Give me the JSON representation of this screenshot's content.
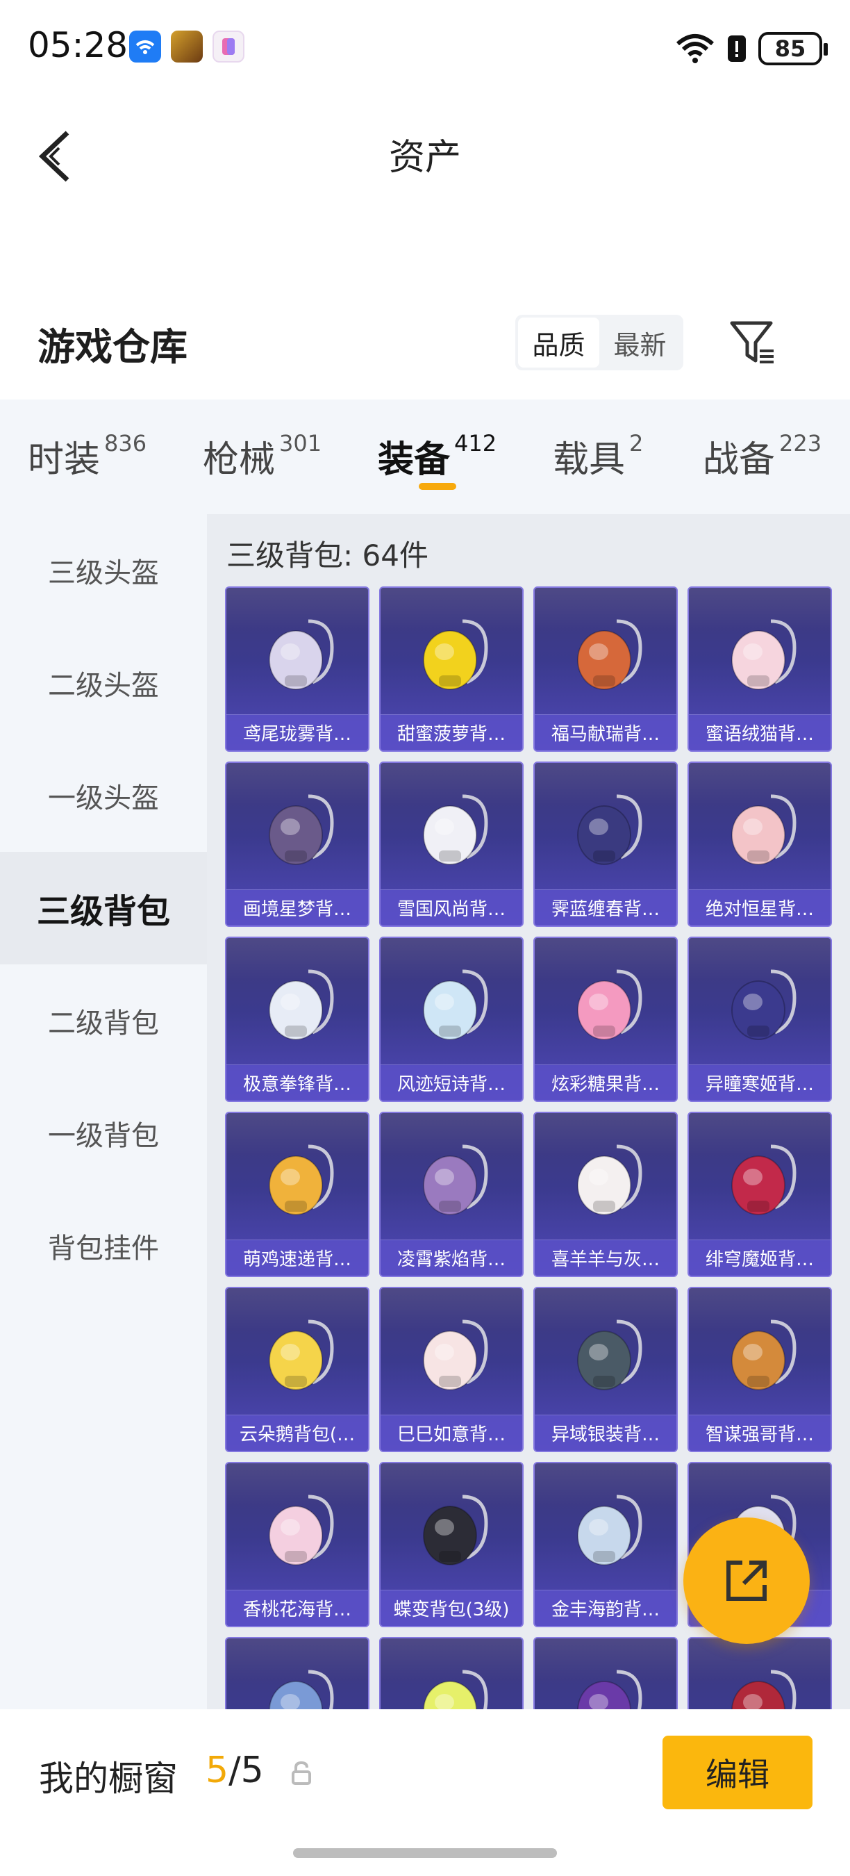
{
  "status_bar": {
    "time": "05:28",
    "battery": "85",
    "icons": [
      "wifi-app-icon",
      "game-app-icon",
      "pink-app-icon",
      "wifi-signal-icon",
      "battery-saver-icon",
      "battery-icon"
    ]
  },
  "header": {
    "title": "资产",
    "back_icon": "chevron-left-icon"
  },
  "warehouse": {
    "title": "游戏仓库",
    "sort_options": [
      "品质",
      "最新"
    ],
    "sort_selected": "品质",
    "filter_icon": "filter-icon"
  },
  "tabs": [
    {
      "label": "时装",
      "count": "836"
    },
    {
      "label": "枪械",
      "count": "301"
    },
    {
      "label": "装备",
      "count": "412",
      "active": true
    },
    {
      "label": "载具",
      "count": "2"
    },
    {
      "label": "战备",
      "count": "223"
    }
  ],
  "sidebar": {
    "items": [
      "三级头盔",
      "二级头盔",
      "一级头盔",
      "三级背包",
      "二级背包",
      "一级背包",
      "背包挂件"
    ],
    "active": "三级背包"
  },
  "content": {
    "title": "三级背包: 64件",
    "items": [
      "鸢尾珑雾背…",
      "甜蜜菠萝背…",
      "福马献瑞背…",
      "蜜语绒猫背…",
      "画境星梦背…",
      "雪国风尚背…",
      "霁蓝缠春背…",
      "绝对恒星背…",
      "极意拳锋背…",
      "风迹短诗背…",
      "炫彩糖果背…",
      "异瞳寒姬背…",
      "萌鸡速递背…",
      "凌霄紫焰背…",
      "喜羊羊与灰…",
      "绯穹魔姬背…",
      "云朵鹅背包(…",
      "巳巳如意背…",
      "异域银装背…",
      "智谋强哥背…",
      "香桃花海背…",
      "蝶变背包(3级)",
      "金丰海韵背…",
      "",
      "",
      "",
      "",
      ""
    ],
    "art_colors": [
      "#d9d4ec",
      "#f2d21d",
      "#d6683a",
      "#f6d5de",
      "#6a5a8a",
      "#f0f0f6",
      "#3a3a80",
      "#f3c4c8",
      "#e7ecf6",
      "#cfe6f6",
      "#f49ac0",
      "#3b3a8e",
      "#f0b23b",
      "#9a7abf",
      "#f4f0f0",
      "#c2294a",
      "#f5d44a",
      "#f7e4e4",
      "#4a5a66",
      "#d48a3b",
      "#f4cfe0",
      "#2c2c36",
      "#c7d8ec",
      "#e0e0f0",
      "#7a9ad6",
      "#e6f06a",
      "#6a3aa8",
      "#b0283a"
    ]
  },
  "fab": {
    "icon": "external-share-icon"
  },
  "showcase": {
    "label": "我的橱窗",
    "used": "5",
    "slash": "/",
    "total": "5",
    "lock_icon": "lock-icon",
    "edit_label": "编辑"
  }
}
